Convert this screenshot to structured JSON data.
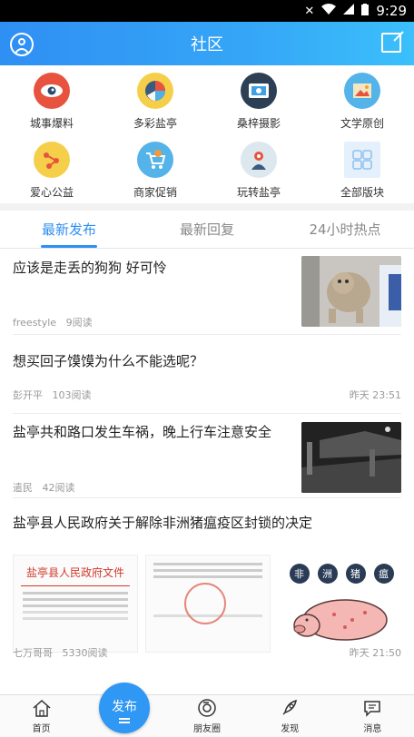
{
  "status": {
    "time": "9:29"
  },
  "header": {
    "title": "社区"
  },
  "categories": [
    {
      "label": "城事爆料",
      "icon": "eye-icon"
    },
    {
      "label": "多彩盐亭",
      "icon": "pie-icon"
    },
    {
      "label": "桑梓摄影",
      "icon": "photo-icon"
    },
    {
      "label": "文学原创",
      "icon": "picture-icon"
    },
    {
      "label": "爱心公益",
      "icon": "network-icon"
    },
    {
      "label": "商家促销",
      "icon": "cart-icon"
    },
    {
      "label": "玩转盐亭",
      "icon": "person-icon"
    },
    {
      "label": "全部版块",
      "icon": "grid-icon"
    }
  ],
  "tabs": [
    {
      "label": "最新发布",
      "active": true
    },
    {
      "label": "最新回复",
      "active": false
    },
    {
      "label": "24小时热点",
      "active": false
    }
  ],
  "posts": [
    {
      "title": "应该是走丢的狗狗 好可怜",
      "author": "freestyle",
      "reads": "9阅读",
      "time": ""
    },
    {
      "title": "想买回子馍馍为什么不能选呢？",
      "author": "彭开平",
      "reads": "103阅读",
      "time": "昨天 23:51"
    },
    {
      "title": "盐亭共和路口发生车祸，晚上行车注意安全",
      "author": "遣民",
      "reads": "42阅读",
      "time": ""
    },
    {
      "title": "盐亭县人民政府关于解除非洲猪瘟疫区封锁的决定",
      "author": "七万哥哥",
      "reads": "5330阅读",
      "time": "昨天 21:50",
      "image_texts": {
        "doc_heading": "盐亭县人民政府文件",
        "pig_banner": [
          "非",
          "洲",
          "猪",
          "瘟"
        ]
      }
    }
  ],
  "bottom_nav": [
    {
      "label": "首页",
      "icon": "home-icon"
    },
    {
      "label": "朋友圈",
      "icon": "camera-icon"
    },
    {
      "label": "发现",
      "icon": "rocket-icon"
    },
    {
      "label": "消息",
      "icon": "chat-icon"
    }
  ],
  "publish": {
    "label": "发布"
  }
}
